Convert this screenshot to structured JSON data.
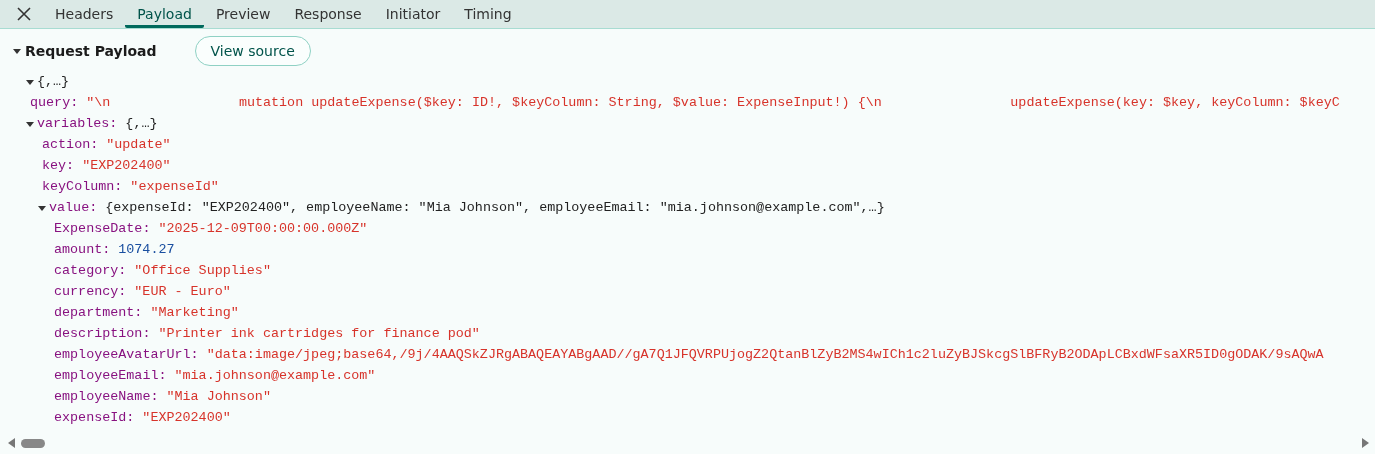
{
  "tabs": [
    {
      "label": "Headers",
      "selected": false
    },
    {
      "label": "Payload",
      "selected": true
    },
    {
      "label": "Preview",
      "selected": false
    },
    {
      "label": "Response",
      "selected": false
    },
    {
      "label": "Initiator",
      "selected": false
    },
    {
      "label": "Timing",
      "selected": false
    }
  ],
  "section": {
    "title": "Request Payload",
    "expanded": true,
    "button": "View source"
  },
  "tree": {
    "summary": "{,…}",
    "expanded": true,
    "children": [
      {
        "key": "query:",
        "kind": "string",
        "value": "\"\\n                mutation updateExpense($key: ID!, $keyColumn: String, $value: ExpenseInput!) {\\n                updateExpense(key: $key, keyColumn: $keyC"
      },
      {
        "key": "variables:",
        "kind": "object",
        "value": "{,…}",
        "expanded": true,
        "children": [
          {
            "key": "action:",
            "kind": "string",
            "value": "\"update\""
          },
          {
            "key": "key:",
            "kind": "string",
            "value": "\"EXP202400\""
          },
          {
            "key": "keyColumn:",
            "kind": "string",
            "value": "\"expenseId\""
          },
          {
            "key": "value:",
            "kind": "object",
            "value": "{expenseId: \"EXP202400\", employeeName: \"Mia Johnson\", employeeEmail: \"mia.johnson@example.com\",…}",
            "expanded": true,
            "children": [
              {
                "key": "ExpenseDate:",
                "kind": "string",
                "value": "\"2025-12-09T00:00:00.000Z\""
              },
              {
                "key": "amount:",
                "kind": "number",
                "value": "1074.27"
              },
              {
                "key": "category:",
                "kind": "string",
                "value": "\"Office Supplies\""
              },
              {
                "key": "currency:",
                "kind": "string",
                "value": "\"EUR - Euro\""
              },
              {
                "key": "department:",
                "kind": "string",
                "value": "\"Marketing\""
              },
              {
                "key": "description:",
                "kind": "string",
                "value": "\"Printer ink cartridges for finance pod\""
              },
              {
                "key": "employeeAvatarUrl:",
                "kind": "string",
                "value": "\"data:image/jpeg;base64,/9j/4AAQSkZJRgABAQEAYABgAAD//gA7Q1JFQVRPUjogZ2QtanBlZyB2MS4wICh1c2luZyBJSkcgSlBFRyB2ODApLCBxdWFsaXR5ID0gODAK/9sAQwA"
              },
              {
                "key": "employeeEmail:",
                "kind": "string",
                "value": "\"mia.johnson@example.com\""
              },
              {
                "key": "employeeName:",
                "kind": "string",
                "value": "\"Mia Johnson\""
              },
              {
                "key": "expenseId:",
                "kind": "string",
                "value": "\"EXP202400\""
              }
            ]
          }
        ]
      }
    ]
  }
}
